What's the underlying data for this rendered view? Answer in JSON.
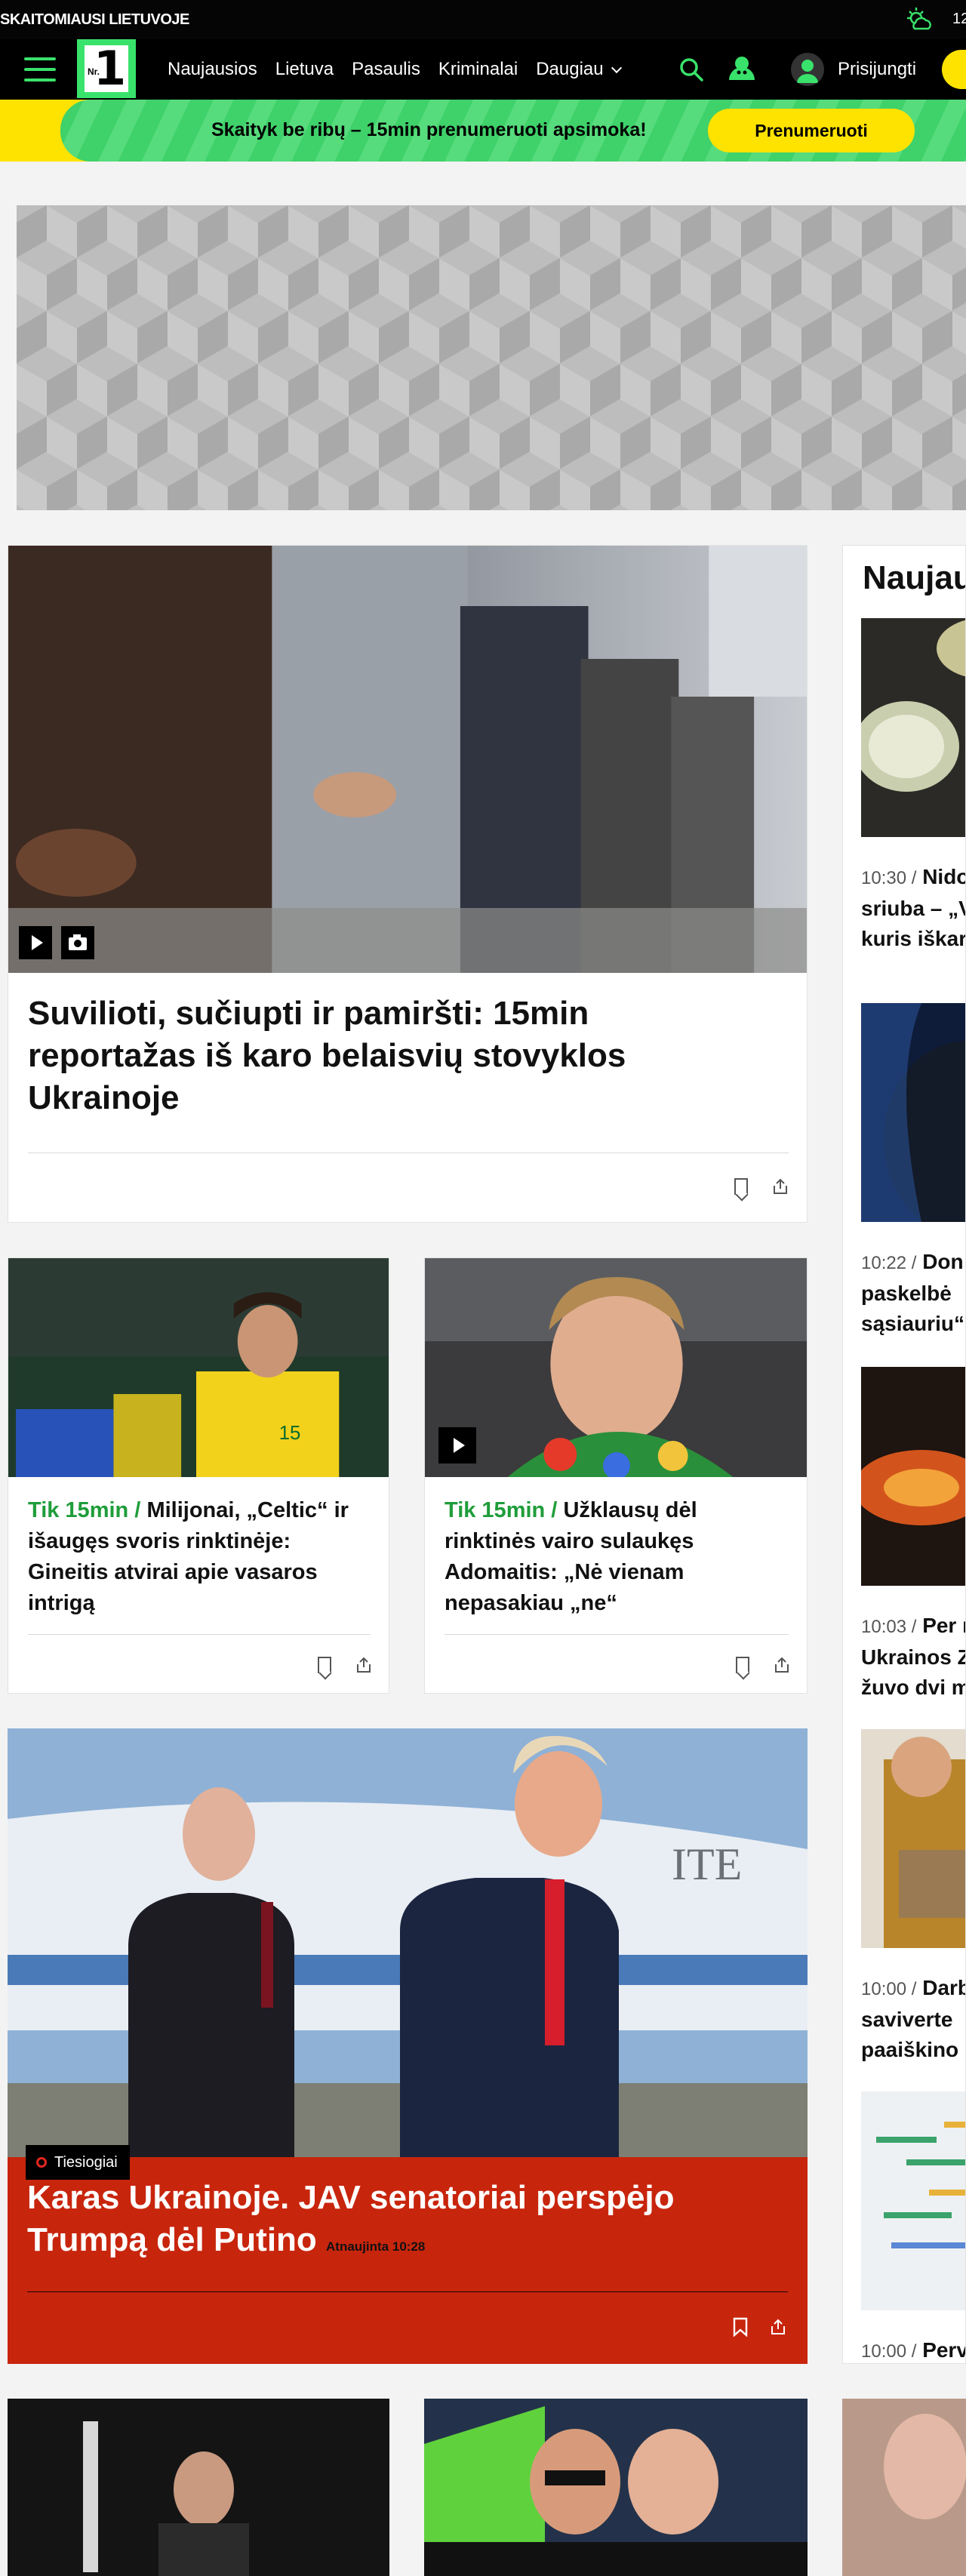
{
  "topbar": {
    "tagline": "SKAITOMIAUSI LIETUVOJE",
    "temp": "12"
  },
  "nav": {
    "logo_text": "1",
    "logo_sub": "Nr.",
    "links": [
      "Naujausios",
      "Lietuva",
      "Pasaulis",
      "Kriminalai",
      "Daugiau"
    ],
    "login": "Prisijungti"
  },
  "promo": {
    "text": "Skaityk be ribų – 15min prenumeruoti apsimoka!",
    "button": "Prenumeruoti"
  },
  "colors": {
    "brand_green": "#39e26b",
    "promo_yellow": "#ffe300",
    "live_red": "#c8250d",
    "tag_green": "#1f9d3a"
  },
  "main_story": {
    "title": "Suvilioti, sučiupti ir pamiršti: 15min reportažas iš karo belaisvių stovyklos Ukrainoje"
  },
  "stories": [
    {
      "tag": "Tik 15min /",
      "title": "Milijonai, „Celtic“ ir išaugęs svoris rinktinėje: Gineitis atvirai apie vasaros intrigą"
    },
    {
      "tag": "Tik 15min /",
      "title": "Užklausų dėl rinktinės vairo sulaukęs Adomaitis: „Nė vienam nepasakiau „ne“"
    }
  ],
  "live_story": {
    "badge": "Tiesiogiai",
    "title": "Karas Ukrainoje. JAV senatoriai perspėjo Trumpą dėl Putino",
    "updated": "Atnaujinta 10:28"
  },
  "sidebar": {
    "heading": "Naujausi",
    "items": [
      {
        "time": "10:30 /",
        "lines": [
          "Nido",
          "sriuba – „V",
          "kuris iškar"
        ]
      },
      {
        "time": "10:22 /",
        "lines": [
          "Don",
          "paskelbė",
          "sąsiauriu“"
        ]
      },
      {
        "time": "10:03 /",
        "lines": [
          "Per n",
          "Ukrainos Z",
          "žuvo dvi m"
        ]
      },
      {
        "time": "10:00 /",
        "lines": [
          "Darb",
          "saviverte",
          "paaiškino"
        ]
      },
      {
        "time": "10:00 /",
        "lines": [
          "Perv"
        ]
      }
    ]
  }
}
